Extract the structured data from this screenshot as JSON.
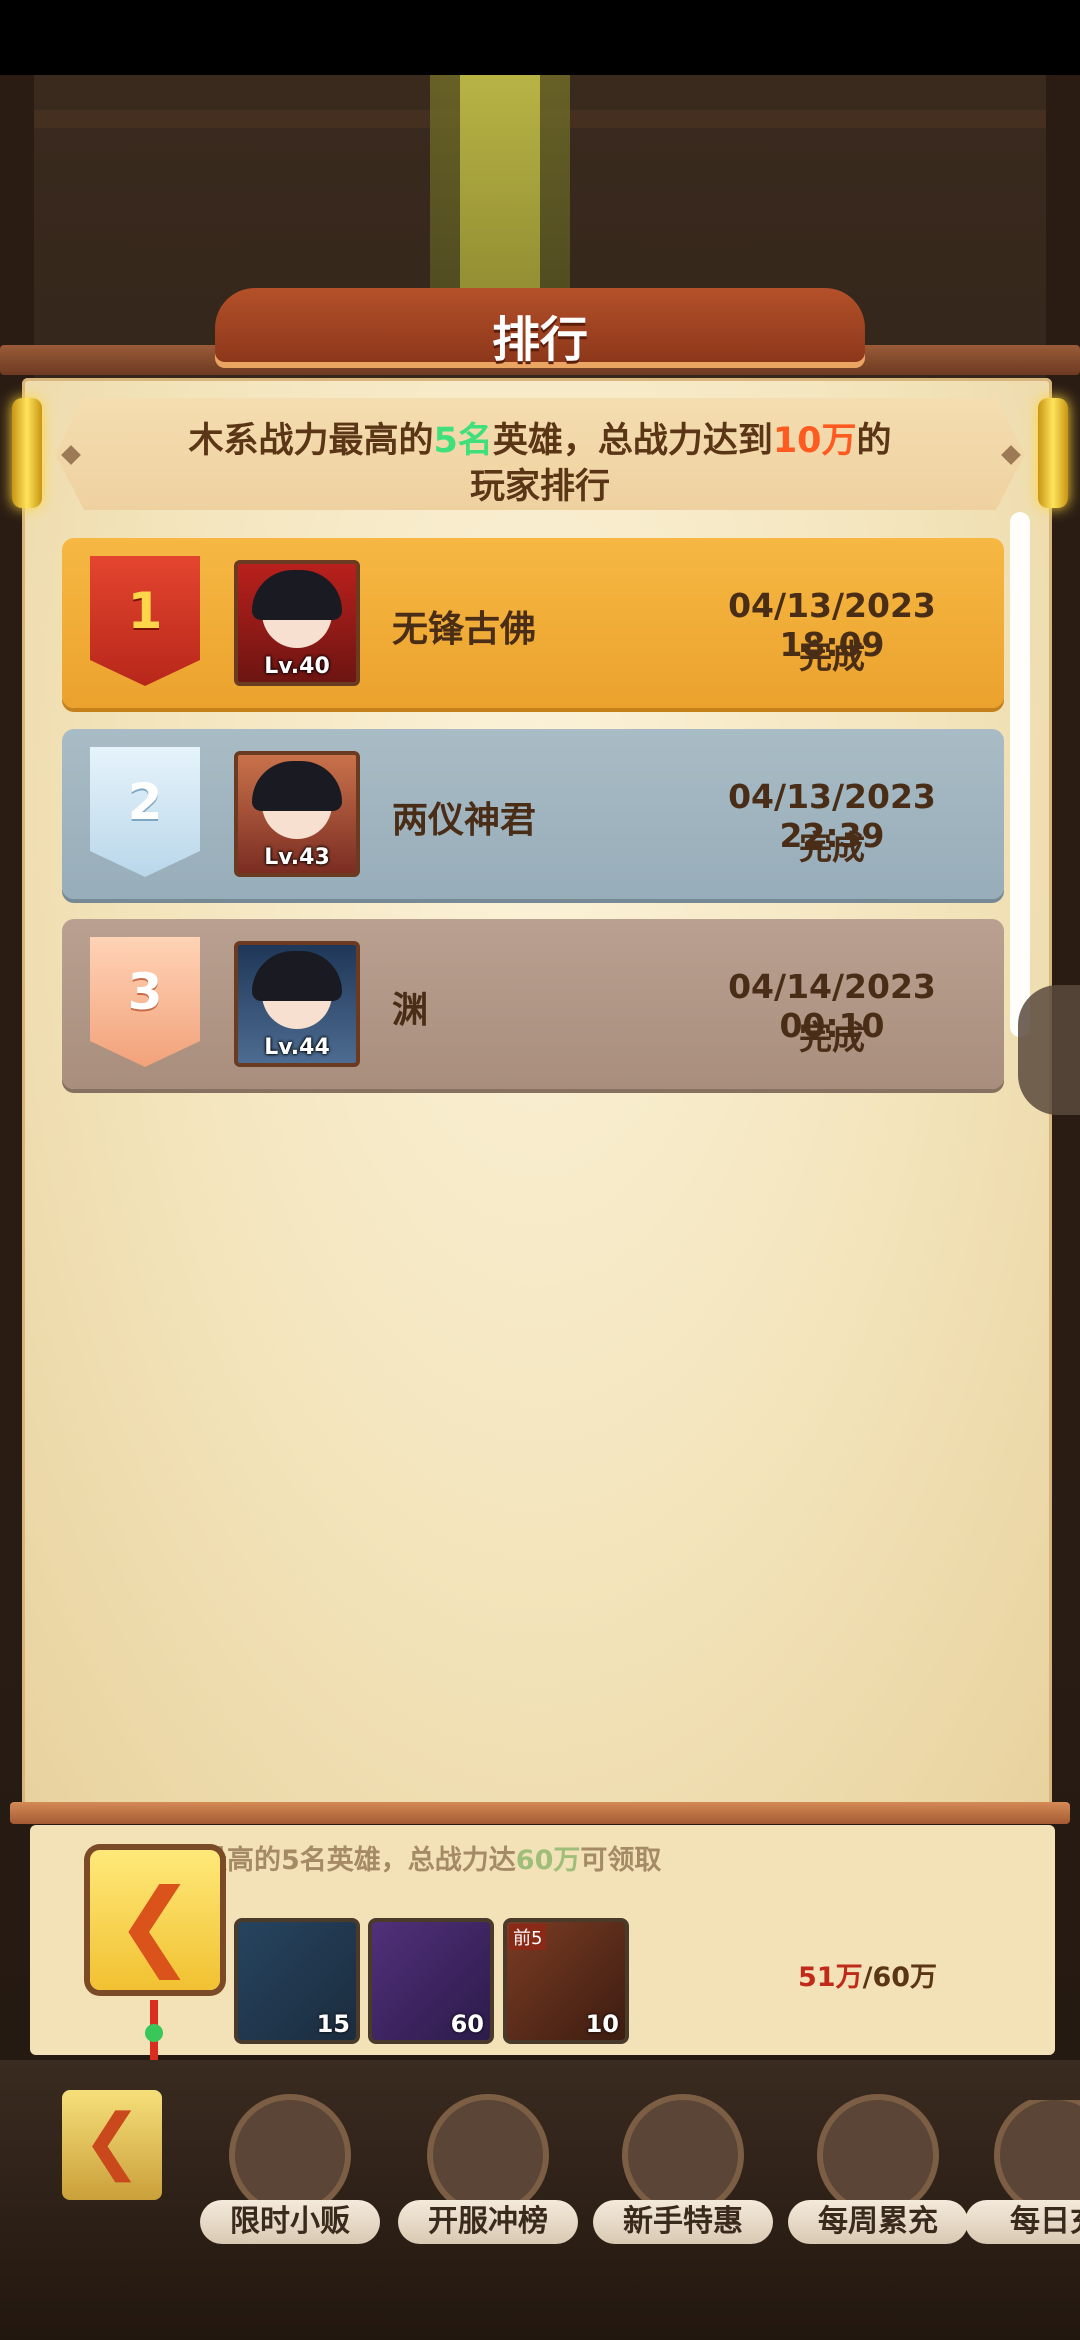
{
  "dialog": {
    "title": "排行",
    "description": {
      "line1_prefix": "木系战力最高的",
      "line1_count": "5名",
      "line1_mid": "英雄，总战力达到",
      "line1_amount": "10万",
      "line1_suffix": "的",
      "line2": "玩家排行"
    },
    "rankings": [
      {
        "rank": "1",
        "level": "Lv.40",
        "name": "无锋古佛",
        "date": "04/13/2023 18:09",
        "status": "完成"
      },
      {
        "rank": "2",
        "level": "Lv.43",
        "name": "两仪神君",
        "date": "04/13/2023 22:39",
        "status": "完成"
      },
      {
        "rank": "3",
        "level": "Lv.44",
        "name": "渊",
        "date": "04/14/2023 00:10",
        "status": "完成"
      }
    ]
  },
  "background_panel": {
    "text_prefix": "最高的5名英雄，总战力达",
    "text_amount": "60万",
    "text_suffix": "可领取",
    "items": [
      {
        "count": "15"
      },
      {
        "count": "60"
      },
      {
        "tag": "前5",
        "count": "10"
      }
    ],
    "progress_current": "51万",
    "progress_total": "/60万"
  },
  "bottom_nav": {
    "items": [
      {
        "label": "限时小贩"
      },
      {
        "label": "开服冲榜"
      },
      {
        "label": "新手特惠"
      },
      {
        "label": "每周累充"
      },
      {
        "label": "每日充"
      }
    ]
  },
  "icons": {
    "back": "back-arrow-icon",
    "colors": {
      "rank1": "#eba22d",
      "rank2": "#97adb9",
      "rank3": "#a98e7d",
      "highlight_green": "#3fe07c",
      "highlight_orange": "#ff5a1f"
    }
  }
}
